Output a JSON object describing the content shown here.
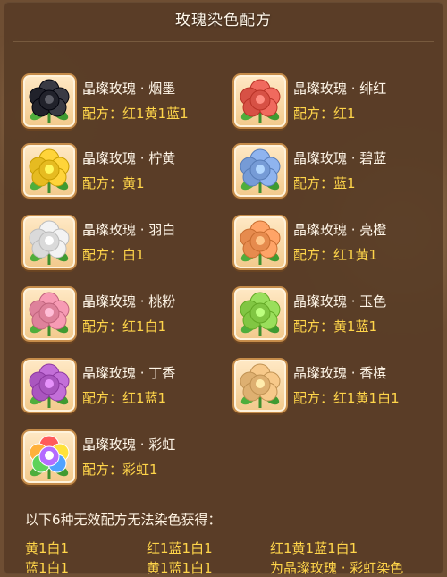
{
  "title": "玫瑰染色配方",
  "recipes": [
    {
      "name": "晶璨玫瑰 · 烟墨",
      "recipe": "配方：红1黄1蓝1",
      "color": "#3a3b44",
      "icon": "rose-ink-icon"
    },
    {
      "name": "晶璨玫瑰 · 绯红",
      "recipe": "配方：红1",
      "color": "#f06a5e",
      "icon": "rose-crimson-icon"
    },
    {
      "name": "晶璨玫瑰 · 柠黄",
      "recipe": "配方：黄1",
      "color": "#ffd43a",
      "icon": "rose-lemon-icon"
    },
    {
      "name": "晶璨玫瑰 · 碧蓝",
      "recipe": "配方：蓝1",
      "color": "#8fb4ef",
      "icon": "rose-azure-icon"
    },
    {
      "name": "晶璨玫瑰 · 羽白",
      "recipe": "配方：白1",
      "color": "#f3f3f3",
      "icon": "rose-white-icon"
    },
    {
      "name": "晶璨玫瑰 · 亮橙",
      "recipe": "配方：红1黄1",
      "color": "#ffa467",
      "icon": "rose-orange-icon"
    },
    {
      "name": "晶璨玫瑰 · 桃粉",
      "recipe": "配方：红1白1",
      "color": "#f79bb4",
      "icon": "rose-peach-icon"
    },
    {
      "name": "晶璨玫瑰 · 玉色",
      "recipe": "配方：黄1蓝1",
      "color": "#9adf5c",
      "icon": "rose-jade-icon"
    },
    {
      "name": "晶璨玫瑰 · 丁香",
      "recipe": "配方：红1蓝1",
      "color": "#c36fd8",
      "icon": "rose-lilac-icon"
    },
    {
      "name": "晶璨玫瑰 · 香槟",
      "recipe": "配方：红1黄1白1",
      "color": "#f7c98a",
      "icon": "rose-champagne-icon"
    },
    {
      "name": "晶璨玫瑰 · 彩虹",
      "recipe": "配方：彩虹1",
      "color": "rainbow",
      "icon": "rose-rainbow-icon"
    }
  ],
  "invalid_note": "以下6种无效配方无法染色获得：",
  "invalid_recipes": [
    "黄1白1",
    "红1蓝1白1",
    "红1黄1蓝1白1",
    "蓝1白1",
    "黄1蓝1白1",
    "为晶璨玫瑰 · 彩虹染色"
  ],
  "colors": {
    "recipe": "#ffd54a",
    "text": "#fff6e8",
    "frame": "#c58c4a"
  }
}
